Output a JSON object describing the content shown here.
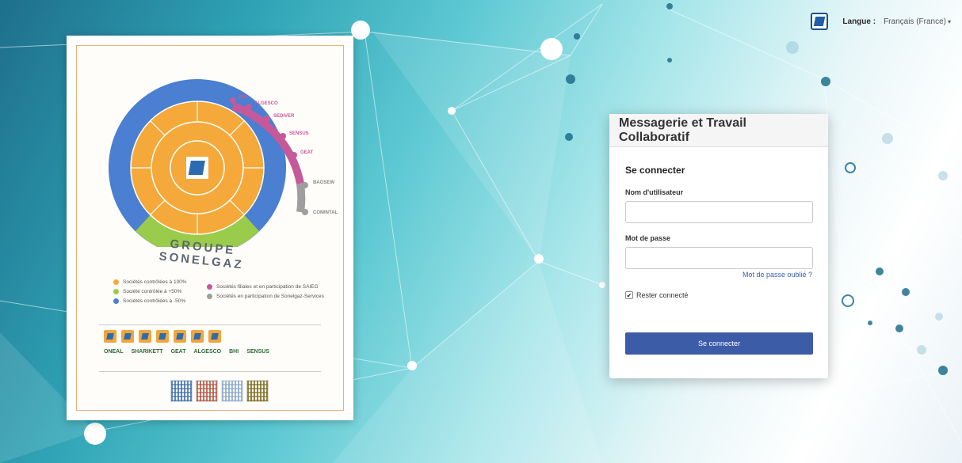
{
  "language_bar": {
    "label": "Langue :",
    "selected": "Français (France)",
    "logo_icon": "app-logo-icon",
    "caret_icon": "caret-down-icon"
  },
  "poster": {
    "outer_labels": [
      "BHI",
      "ALGESCO",
      "SEDIVER",
      "SENSUS",
      "GEAT",
      "BAOSEW",
      "COMINTAL"
    ],
    "group_title": "GROUPE SONELGAZ",
    "legend": [
      {
        "color": "#f4a93a",
        "text": "Sociétés contrôlées à 100%"
      },
      {
        "color": "#9acb4a",
        "text": "Société contrôlée à +50%"
      },
      {
        "color": "#4a7fd1",
        "text": "Sociétés contrôlées à -50%"
      }
    ],
    "legend_right": [
      {
        "color": "#c45a9a",
        "text": "Sociétés filiales et en participation de SAIEG"
      },
      {
        "color": "#9e9e9e",
        "text": "Sociétés en participation de Sonelgaz-Services"
      }
    ],
    "brand_names": [
      "ONEAL",
      "SHARIKETT",
      "GEAT",
      "ALGESCO",
      "BHI",
      "SENSUS"
    ]
  },
  "login": {
    "title": "Messagerie et Travail Collaboratif",
    "subtitle": "Se connecter",
    "username_label": "Nom d'utilisateur",
    "username_value": "",
    "password_label": "Mot de passe",
    "password_value": "",
    "forgot_link": "Mot de passe oublié ?",
    "remember_label": "Rester connecté",
    "remember_checked": "✔",
    "submit_label": "Se connecter"
  },
  "colors": {
    "accent": "#3c5ca8",
    "link": "#3b5fb3"
  }
}
